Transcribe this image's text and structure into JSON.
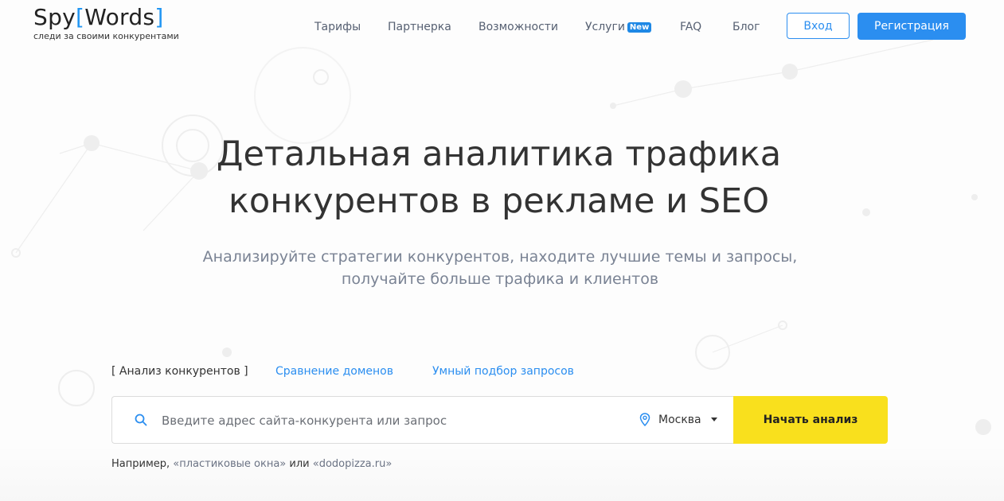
{
  "logo": {
    "name_left": "Spy",
    "bracket_open": "[",
    "name_right": "Words",
    "bracket_close": "]",
    "tagline": "следи за своими конкурентами"
  },
  "nav": {
    "items": [
      {
        "label": "Тарифы"
      },
      {
        "label": "Партнерка"
      },
      {
        "label": "Возможности"
      },
      {
        "label": "Услуги",
        "badge": "New"
      },
      {
        "label": "FAQ"
      },
      {
        "label": "Блог"
      }
    ],
    "login": "Вход",
    "register": "Регистрация"
  },
  "hero": {
    "title_line1": "Детальная аналитика трафика",
    "title_line2": "конкурентов в рекламе и SEO",
    "subtitle_line1": "Анализируйте стратегии конкурентов, находите лучшие темы и запросы,",
    "subtitle_line2": "получайте больше трафика и клиентов"
  },
  "tabs": [
    {
      "label": "[ Анализ конкурентов ]",
      "active": true
    },
    {
      "label": "Сравнение доменов",
      "active": false
    },
    {
      "label": "Умный подбор запросов",
      "active": false
    }
  ],
  "search": {
    "value": "",
    "placeholder": "Введите адрес сайта-конкурента или запрос",
    "location": "Москва",
    "button": "Начать анализ"
  },
  "example": {
    "prefix": "Например,",
    "example1": "«пластиковые окна»",
    "middle": "или",
    "example2": "«dodopizza.ru»"
  },
  "colors": {
    "accent": "#2b8ef0",
    "cta": "#f9e01d",
    "badge": "#1e88e5"
  },
  "icons": [
    "search-icon",
    "location-pin-icon",
    "caret-down-icon"
  ]
}
